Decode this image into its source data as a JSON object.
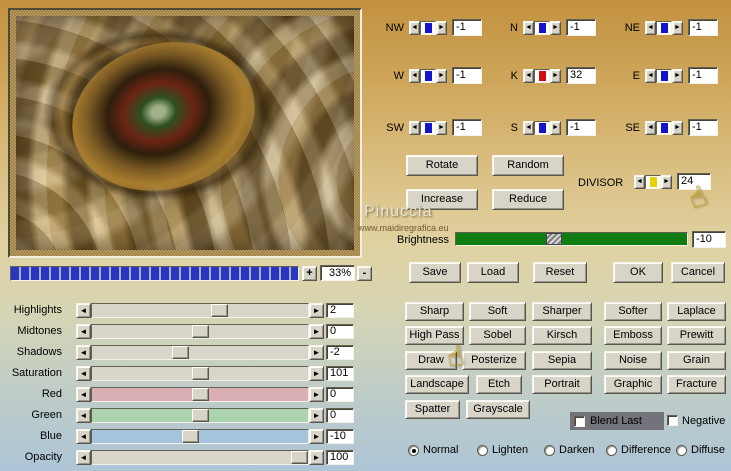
{
  "icons": {
    "left_arrow": "◄",
    "right_arrow": "►",
    "hand_pointer": "☝"
  },
  "colors": {
    "zoom_segment": "#2a35c0",
    "kernel_bar": "#1414cc",
    "k_center_bar": "#d01010",
    "divisor_bar": "#e6d300",
    "brightness_green": "#0f7d12"
  },
  "zoom": {
    "plus": "+",
    "value": "33%",
    "minus": "-"
  },
  "adjust_sliders": [
    {
      "label": "Highlights",
      "value": "2",
      "fraction": 0.6,
      "track_color": "#d9d5cb"
    },
    {
      "label": "Midtones",
      "value": "0",
      "fraction": 0.5,
      "track_color": "#d9d5cb"
    },
    {
      "label": "Shadows",
      "value": "-2",
      "fraction": 0.4,
      "track_color": "#d9d5cb"
    },
    {
      "label": "Saturation",
      "value": "101",
      "fraction": 0.505,
      "track_color": "#d9d5cb"
    },
    {
      "label": "Red",
      "value": "0",
      "fraction": 0.5,
      "track_color": "#d9aeb5"
    },
    {
      "label": "Green",
      "value": "0",
      "fraction": 0.5,
      "track_color": "#abd3ad"
    },
    {
      "label": "Blue",
      "value": "-10",
      "fraction": 0.45,
      "track_color": "#a5c3dc"
    },
    {
      "label": "Opacity",
      "value": "100",
      "fraction": 1,
      "track_color": "#d9d5cb"
    }
  ],
  "kernel": {
    "cells": [
      {
        "label": "NW",
        "value": "-1",
        "bar_color": "#1414cc"
      },
      {
        "label": "N",
        "value": "-1",
        "bar_color": "#1414cc"
      },
      {
        "label": "NE",
        "value": "-1",
        "bar_color": "#1414cc"
      },
      {
        "label": "W",
        "value": "-1",
        "bar_color": "#1414cc"
      },
      {
        "label": "K",
        "value": "32",
        "bar_color": "#d01010"
      },
      {
        "label": "E",
        "value": "-1",
        "bar_color": "#1414cc"
      },
      {
        "label": "SW",
        "value": "-1",
        "bar_color": "#1414cc"
      },
      {
        "label": "S",
        "value": "-1",
        "bar_color": "#1414cc"
      },
      {
        "label": "SE",
        "value": "-1",
        "bar_color": "#1414cc"
      }
    ]
  },
  "matrix": {
    "rotate": "Rotate",
    "random": "Random",
    "increase": "Increase",
    "reduce": "Reduce"
  },
  "divisor": {
    "label": "DIVISOR",
    "value": "24",
    "bar_color": "#e6d300"
  },
  "brightness": {
    "label": "Brightness",
    "value": "-10",
    "fraction": 0.42,
    "track_color": "#0f7d12"
  },
  "actions": {
    "save": "Save",
    "load": "Load",
    "reset": "Reset",
    "ok": "OK",
    "cancel": "Cancel"
  },
  "filters": [
    [
      "Sharp",
      "Soft",
      "Sharper",
      "Softer",
      "Laplace"
    ],
    [
      "High Pass",
      "Sobel",
      "Kirsch",
      "Emboss",
      "Prewitt"
    ],
    [
      "Draw",
      "Posterize",
      "Sepia",
      "Noise",
      "Grain"
    ],
    [
      "Landscape",
      "Etch",
      "Portrait",
      "Graphic",
      "Fracture"
    ],
    [
      "Spatter",
      "Grayscale"
    ]
  ],
  "checkboxes": [
    {
      "label": "Blend Last",
      "checked": false
    },
    {
      "label": "Negative",
      "checked": false
    }
  ],
  "blend_modes": [
    {
      "label": "Normal",
      "selected": true
    },
    {
      "label": "Lighten",
      "selected": false
    },
    {
      "label": "Darken",
      "selected": false
    },
    {
      "label": "Difference",
      "selected": false
    },
    {
      "label": "Diffuse",
      "selected": false
    }
  ],
  "watermark": {
    "name": "Pinuccia",
    "site": "www.maidiregrafica.eu"
  }
}
